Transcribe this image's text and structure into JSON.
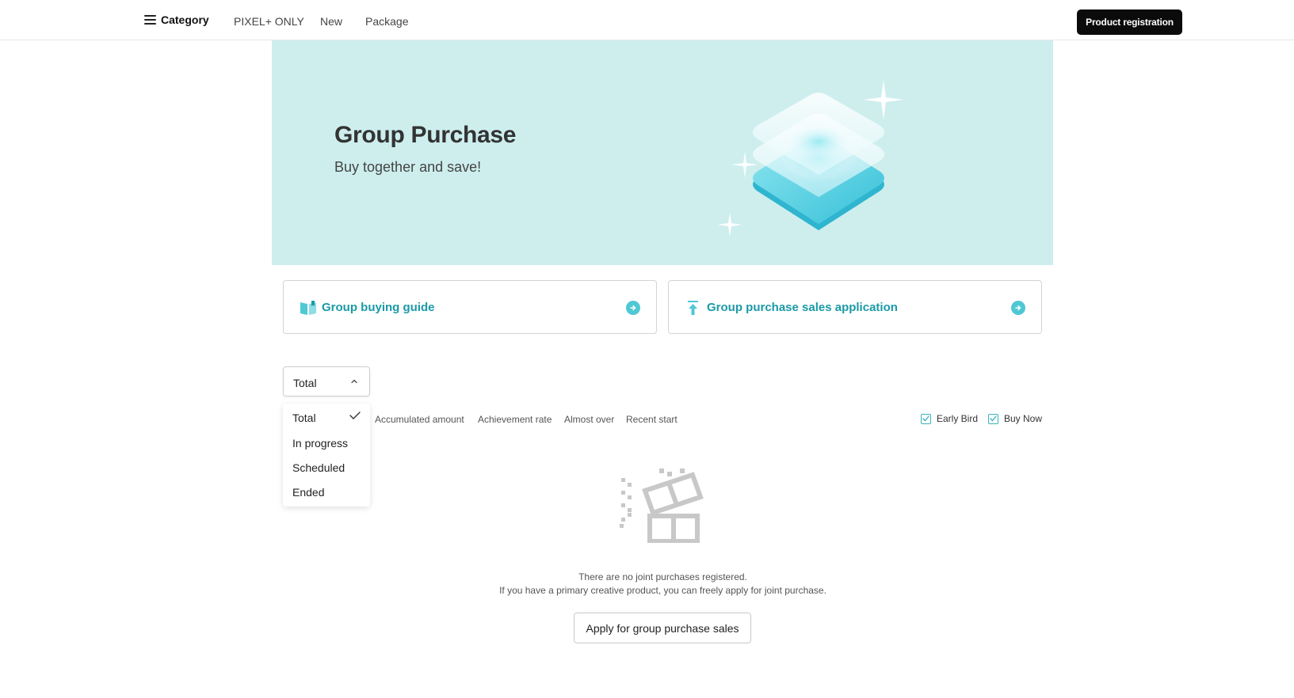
{
  "nav": {
    "category_label": "Category",
    "links": [
      "PIXEL+ ONLY",
      "New",
      "Package"
    ],
    "register_label": "Product registration"
  },
  "banner": {
    "title": "Group Purchase",
    "subtitle": "Buy together and save!",
    "bg_color": "#ceeeee"
  },
  "cards": [
    {
      "label": "Group buying guide",
      "icon": "book-icon"
    },
    {
      "label": "Group purchase sales application",
      "icon": "upload-arrow-icon"
    }
  ],
  "filter": {
    "selected": "Total",
    "options": [
      "Total",
      "In progress",
      "Scheduled",
      "Ended"
    ]
  },
  "sort_options": [
    "Accumulated amount",
    "Achievement rate",
    "Almost over",
    "Recent start"
  ],
  "toggles": [
    {
      "label": "Early Bird",
      "checked": true
    },
    {
      "label": "Buy Now",
      "checked": true
    }
  ],
  "empty": {
    "line1": "There are no joint purchases registered.",
    "line2": "If you have a primary creative product, you can freely apply for joint purchase.",
    "button_label": "Apply for group purchase sales"
  },
  "colors": {
    "accent": "#1a9aa6",
    "accent_light": "#4fc8d4",
    "dark_button": "#0b0b0b"
  }
}
